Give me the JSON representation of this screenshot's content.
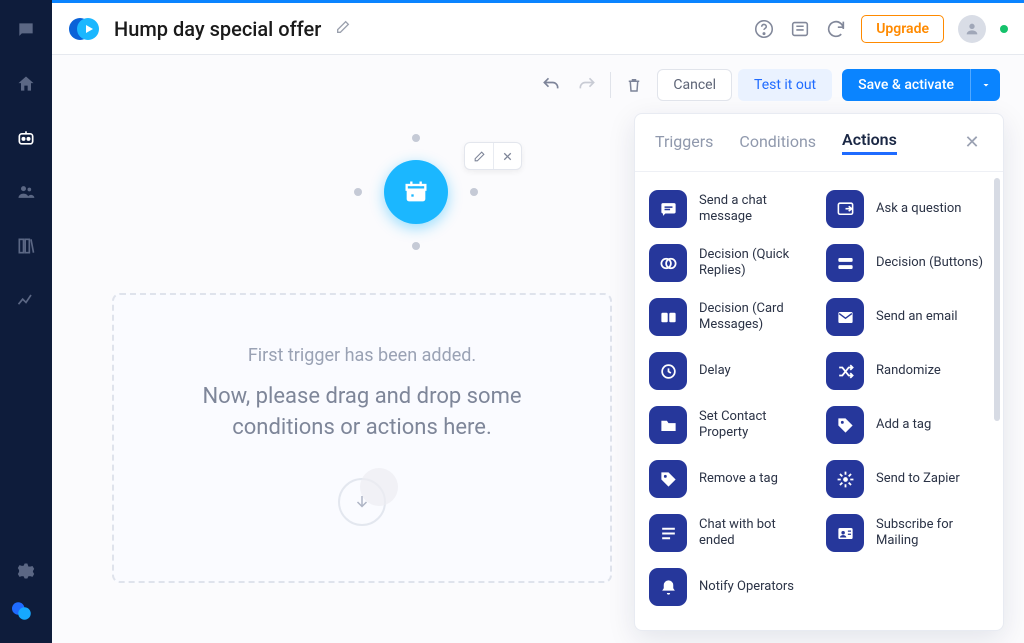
{
  "header": {
    "title": "Hump day special offer",
    "upgrade_label": "Upgrade"
  },
  "toolbar": {
    "cancel_label": "Cancel",
    "test_label": "Test it out",
    "save_label": "Save & activate"
  },
  "canvas": {
    "dz_line1": "First trigger has been added.",
    "dz_line2": "Now, please drag and drop some conditions or actions here."
  },
  "panel": {
    "tabs": {
      "triggers": "Triggers",
      "conditions": "Conditions",
      "actions": "Actions"
    },
    "active_tab": "actions",
    "actions": [
      {
        "id": "send-chat",
        "label": "Send a chat message",
        "icon": "chat"
      },
      {
        "id": "ask-question",
        "label": "Ask a question",
        "icon": "question"
      },
      {
        "id": "decision-quick",
        "label": "Decision (Quick Replies)",
        "icon": "quick"
      },
      {
        "id": "decision-buttons",
        "label": "Decision (Buttons)",
        "icon": "buttons"
      },
      {
        "id": "decision-card",
        "label": "Decision (Card Messages)",
        "icon": "cards"
      },
      {
        "id": "send-email",
        "label": "Send an email",
        "icon": "email"
      },
      {
        "id": "delay",
        "label": "Delay",
        "icon": "clock"
      },
      {
        "id": "randomize",
        "label": "Randomize",
        "icon": "shuffle"
      },
      {
        "id": "set-contact",
        "label": "Set Contact Property",
        "icon": "folder"
      },
      {
        "id": "add-tag",
        "label": "Add a tag",
        "icon": "tag"
      },
      {
        "id": "remove-tag",
        "label": "Remove a tag",
        "icon": "tag"
      },
      {
        "id": "send-zapier",
        "label": "Send to Zapier",
        "icon": "zap"
      },
      {
        "id": "chat-end",
        "label": "Chat with bot ended",
        "icon": "list"
      },
      {
        "id": "subscribe",
        "label": "Subscribe for Mailing",
        "icon": "idcard"
      },
      {
        "id": "notify",
        "label": "Notify Operators",
        "icon": "bell"
      }
    ]
  }
}
